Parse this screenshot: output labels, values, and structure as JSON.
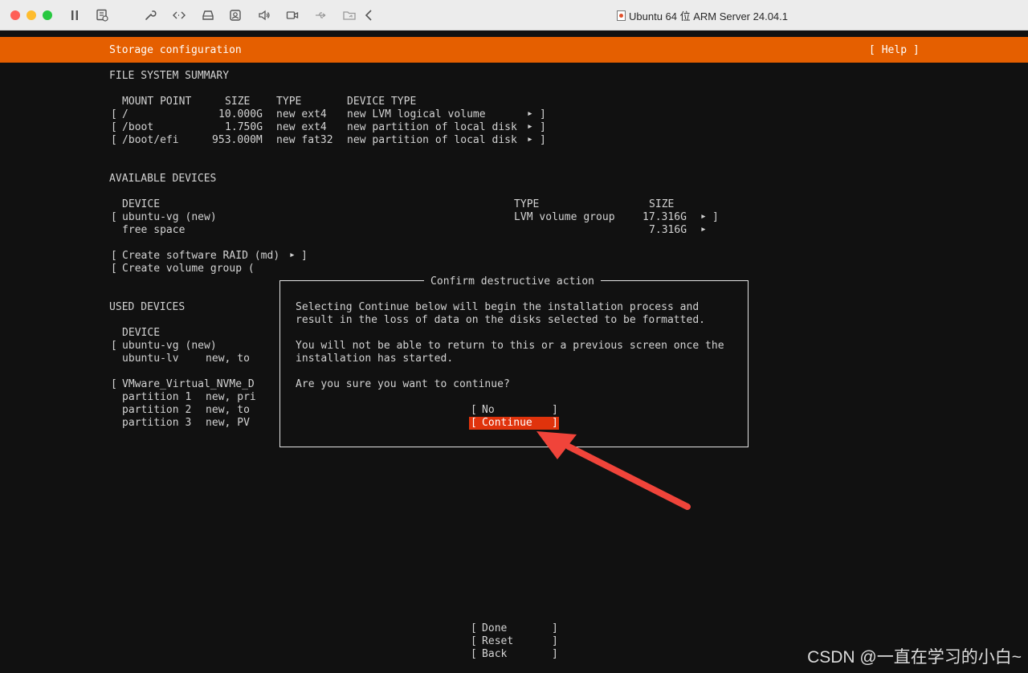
{
  "window": {
    "title": "Ubuntu 64 位 ARM Server 24.04.1",
    "traffic_colors": [
      "#fe5f57",
      "#febc2e",
      "#28c840"
    ],
    "toolbar_icons": [
      "pause-icon",
      "snapshot-icon",
      "settings-wrench-icon",
      "code-brackets-icon",
      "disk-drive-icon",
      "user-lock-icon",
      "volume-icon",
      "camera-icon",
      "usb-icon",
      "shared-folder-icon",
      "back-chevron-icon"
    ]
  },
  "header": {
    "title": "Storage configuration",
    "help": "[ Help ]",
    "accent": "#e55f00"
  },
  "fs_summary": {
    "heading": "FILE SYSTEM SUMMARY",
    "columns": [
      "MOUNT POINT",
      "SIZE",
      "TYPE",
      "DEVICE TYPE"
    ],
    "rows": [
      {
        "mount": "/",
        "size": "10.000G",
        "type": "new ext4",
        "device_type": "new LVM logical volume"
      },
      {
        "mount": "/boot",
        "size": "1.750G",
        "type": "new ext4",
        "device_type": "new partition of local disk"
      },
      {
        "mount": "/boot/efi",
        "size": "953.000M",
        "type": "new fat32",
        "device_type": "new partition of local disk"
      }
    ]
  },
  "available": {
    "heading": "AVAILABLE DEVICES",
    "col_device": "DEVICE",
    "col_type": "TYPE",
    "col_size": "SIZE",
    "rows": [
      {
        "device": "ubuntu-vg (new)",
        "type": "LVM volume group",
        "size": "17.316G"
      },
      {
        "device": "free space",
        "type": "",
        "size": "7.316G"
      }
    ],
    "create_raid": "Create software RAID (md)",
    "create_vg": "Create volume group ("
  },
  "used": {
    "heading": "USED DEVICES",
    "col_device": "DEVICE",
    "rows": [
      {
        "name": "ubuntu-vg (new)",
        "detail": ""
      },
      {
        "name": "ubuntu-lv",
        "detail": "new, to"
      },
      {
        "name": "VMware_Virtual_NVMe_D",
        "detail": ""
      },
      {
        "name": "partition 1",
        "detail": "new, pri"
      },
      {
        "name": "partition 2",
        "detail": "new, to"
      },
      {
        "name": "partition 3",
        "detail": "new, PV"
      }
    ]
  },
  "dialog": {
    "title": "Confirm destructive action",
    "line1": "Selecting Continue below will begin the installation process and",
    "line2": "result in the loss of data on the disks selected to be formatted.",
    "line3": "You will not be able to return to this or a previous screen once the",
    "line4": "installation has started.",
    "question": "Are you sure you want to continue?",
    "no_label": "No",
    "continue_label": "Continue",
    "selected_color": "#e0330c"
  },
  "footer": {
    "done": "Done",
    "reset": "Reset",
    "back": "Back"
  },
  "watermark": "CSDN @一直在学习的小白~",
  "annotation_arrow_color": "#f0443a",
  "symbols": {
    "lb": "[",
    "rb": "]",
    "tri": "▸"
  }
}
